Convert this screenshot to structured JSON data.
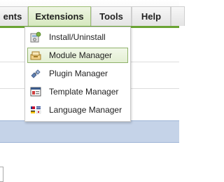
{
  "menubar": {
    "items": [
      {
        "label": "ents"
      },
      {
        "label": "Extensions"
      },
      {
        "label": "Tools"
      },
      {
        "label": "Help"
      }
    ]
  },
  "extensions_menu": {
    "items": [
      {
        "label": "Install/Uninstall",
        "icon": "install-icon"
      },
      {
        "label": "Module Manager",
        "icon": "module-icon"
      },
      {
        "label": "Plugin Manager",
        "icon": "plugin-icon"
      },
      {
        "label": "Template Manager",
        "icon": "template-icon"
      },
      {
        "label": "Language Manager",
        "icon": "language-icon"
      }
    ],
    "highlighted": "Module Manager"
  },
  "colors": {
    "accent_green": "#6aa334",
    "highlight_border": "#8fb26a",
    "blue_band": "#c5d3e8"
  }
}
